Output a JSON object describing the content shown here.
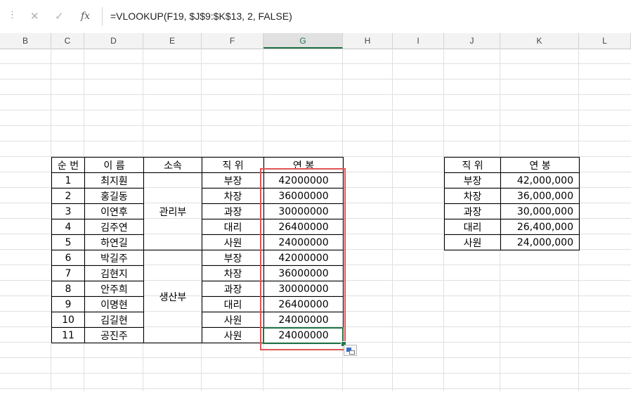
{
  "formula_bar": {
    "dots": "⋮",
    "cancel_icon": "✕",
    "enter_icon": "✓",
    "fx_label": "fx",
    "formula": "=VLOOKUP(F19, $J$9:$K$13, 2, FALSE)"
  },
  "columns": [
    {
      "label": "B"
    },
    {
      "label": "C"
    },
    {
      "label": "D"
    },
    {
      "label": "E"
    },
    {
      "label": "F"
    },
    {
      "label": "G",
      "selected": true
    },
    {
      "label": "H"
    },
    {
      "label": "I"
    },
    {
      "label": "J"
    },
    {
      "label": "K"
    },
    {
      "label": "L"
    }
  ],
  "main_table": {
    "headers": [
      "순 번",
      "이 름",
      "소속",
      "직 위",
      "연 봉"
    ],
    "departments": [
      "관리부",
      "생산부"
    ],
    "rows": [
      [
        "1",
        "최지훤",
        "부장",
        "42000000"
      ],
      [
        "2",
        "홍길동",
        "차장",
        "36000000"
      ],
      [
        "3",
        "이연후",
        "과장",
        "30000000"
      ],
      [
        "4",
        "김주연",
        "대리",
        "26400000"
      ],
      [
        "5",
        "하연길",
        "사원",
        "24000000"
      ],
      [
        "6",
        "박길주",
        "부장",
        "42000000"
      ],
      [
        "7",
        "김현지",
        "차장",
        "36000000"
      ],
      [
        "8",
        "안주희",
        "과장",
        "30000000"
      ],
      [
        "9",
        "이명현",
        "대리",
        "26400000"
      ],
      [
        "10",
        "김길현",
        "사원",
        "24000000"
      ],
      [
        "11",
        "공진주",
        "사원",
        "24000000"
      ]
    ]
  },
  "lookup_table": {
    "headers": [
      "직 위",
      "연 봉"
    ],
    "rows": [
      [
        "부장",
        "42,000,000"
      ],
      [
        "차장",
        "36,000,000"
      ],
      [
        "과장",
        "30,000,000"
      ],
      [
        "대리",
        "26,400,000"
      ],
      [
        "사원",
        "24,000,000"
      ]
    ]
  },
  "colors": {
    "accent": "#217346",
    "highlight": "#e05555",
    "gridline": "#e0e0e0"
  }
}
